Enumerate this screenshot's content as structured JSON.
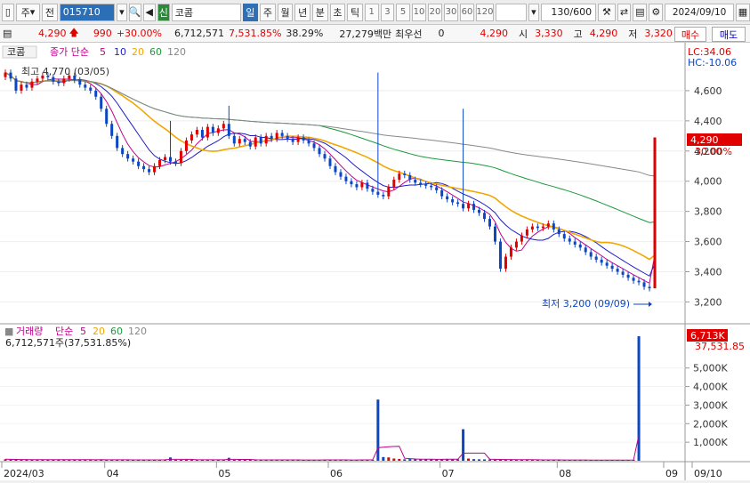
{
  "toolbar": {
    "market_label": "주",
    "prev_label": "전",
    "stock_code": "015710",
    "new_badge": "신",
    "stock_name": "코콤",
    "periods": [
      "일",
      "주",
      "월",
      "년",
      "분",
      "초",
      "틱"
    ],
    "active_period": "일",
    "intervals": [
      "1",
      "3",
      "5",
      "10",
      "20",
      "30",
      "60",
      "120"
    ],
    "count": "130/600",
    "date": "2024/09/10"
  },
  "quote": {
    "price": "4,290",
    "change": "990",
    "change_pct": "+30.00%",
    "volume": "6,712,571",
    "volume_ratio": "7,531.85%",
    "turnover": "38.29%",
    "amount": "27,279백만",
    "priority_label": "최우선",
    "priority_value": "0",
    "current": "4,290",
    "open_label": "시",
    "open": "3,330",
    "high_label": "고",
    "high": "4,290",
    "low_label": "저",
    "low": "3,320",
    "buy_label": "매수",
    "sell_label": "매도"
  },
  "price_panel": {
    "title": "코콤",
    "ma_label": "종가 단순",
    "ma_periods": [
      "5",
      "10",
      "20",
      "60",
      "120"
    ],
    "lc": "LC:34.06",
    "hc": "HC:-10.06",
    "high_note": "최고 4,770 (03/05)",
    "low_note": "최저 3,200 (09/09)",
    "price_tag": "4,290",
    "pct_tag": "30.00%",
    "y_ticks": [
      "4,600",
      "4,400",
      "4,200",
      "4,000",
      "3,800",
      "3,600",
      "3,400",
      "3,200"
    ]
  },
  "volume_panel": {
    "title": "거래량",
    "ma_label": "단순",
    "ma_periods": [
      "5",
      "20",
      "60",
      "120"
    ],
    "summary": "6,712,571주(37,531.85%)",
    "vol_tag": "6,713K",
    "pct_tag": "37,531.85",
    "y_ticks": [
      "5,000K",
      "4,000K",
      "3,000K",
      "2,000K",
      "1,000K"
    ]
  },
  "x_labels": [
    "2024/03",
    "04",
    "05",
    "06",
    "07",
    "08",
    "09",
    "09/10"
  ],
  "colors": {
    "up": "#e00000",
    "down": "#0b46c5",
    "ma5": "#c0008c",
    "ma10": "#1e1ec8",
    "ma20": "#f0a800",
    "ma60": "#1a9a3a",
    "ma120": "#888888"
  },
  "chart_data": {
    "type": "candlestick",
    "ylim": [
      3120,
      4800
    ],
    "closes": [
      4720,
      4680,
      4600,
      4640,
      4620,
      4660,
      4680,
      4700,
      4690,
      4660,
      4650,
      4680,
      4700,
      4670,
      4640,
      4620,
      4600,
      4560,
      4480,
      4380,
      4300,
      4220,
      4180,
      4150,
      4130,
      4100,
      4080,
      4060,
      4100,
      4140,
      4160,
      4130,
      4120,
      4200,
      4270,
      4310,
      4340,
      4290,
      4360,
      4320,
      4350,
      4380,
      4300,
      4250,
      4280,
      4260,
      4230,
      4290,
      4250,
      4300,
      4280,
      4320,
      4300,
      4280,
      4260,
      4290,
      4270,
      4250,
      4220,
      4180,
      4150,
      4100,
      4060,
      4030,
      4000,
      3980,
      3960,
      3990,
      3950,
      3930,
      3910,
      3900,
      3960,
      4010,
      4050,
      4040,
      4010,
      3990,
      3980,
      3970,
      3960,
      3940,
      3900,
      3880,
      3860,
      3850,
      3820,
      3850,
      3810,
      3790,
      3750,
      3700,
      3600,
      3420,
      3500,
      3560,
      3600,
      3640,
      3680,
      3700,
      3690,
      3700,
      3720,
      3680,
      3650,
      3620,
      3600,
      3580,
      3560,
      3530,
      3500,
      3480,
      3460,
      3440,
      3420,
      3400,
      3380,
      3360,
      3340,
      3330,
      3300,
      3290,
      4290
    ],
    "volume_k": [
      80,
      70,
      60,
      65,
      60,
      58,
      55,
      60,
      62,
      58,
      55,
      60,
      58,
      52,
      55,
      60,
      58,
      50,
      55,
      52,
      50,
      48,
      55,
      50,
      48,
      45,
      48,
      50,
      55,
      52,
      50,
      180,
      50,
      48,
      60,
      55,
      52,
      50,
      58,
      55,
      52,
      50,
      160,
      55,
      50,
      48,
      52,
      50,
      48,
      45,
      50,
      48,
      46,
      44,
      48,
      45,
      42,
      44,
      46,
      48,
      50,
      48,
      45,
      42,
      44,
      46,
      48,
      50,
      52,
      48,
      3300,
      200,
      180,
      120,
      100,
      80,
      90,
      85,
      70,
      75,
      80,
      70,
      85,
      90,
      80,
      75,
      1700,
      120,
      90,
      80,
      75,
      70,
      65,
      60,
      65,
      70,
      60,
      55,
      50,
      45,
      50,
      48,
      44,
      46,
      42,
      45,
      40,
      38,
      42,
      40,
      38,
      40,
      35,
      38,
      36,
      40,
      42,
      45,
      48,
      6713
    ],
    "yvol_lim": [
      0,
      6713
    ]
  }
}
